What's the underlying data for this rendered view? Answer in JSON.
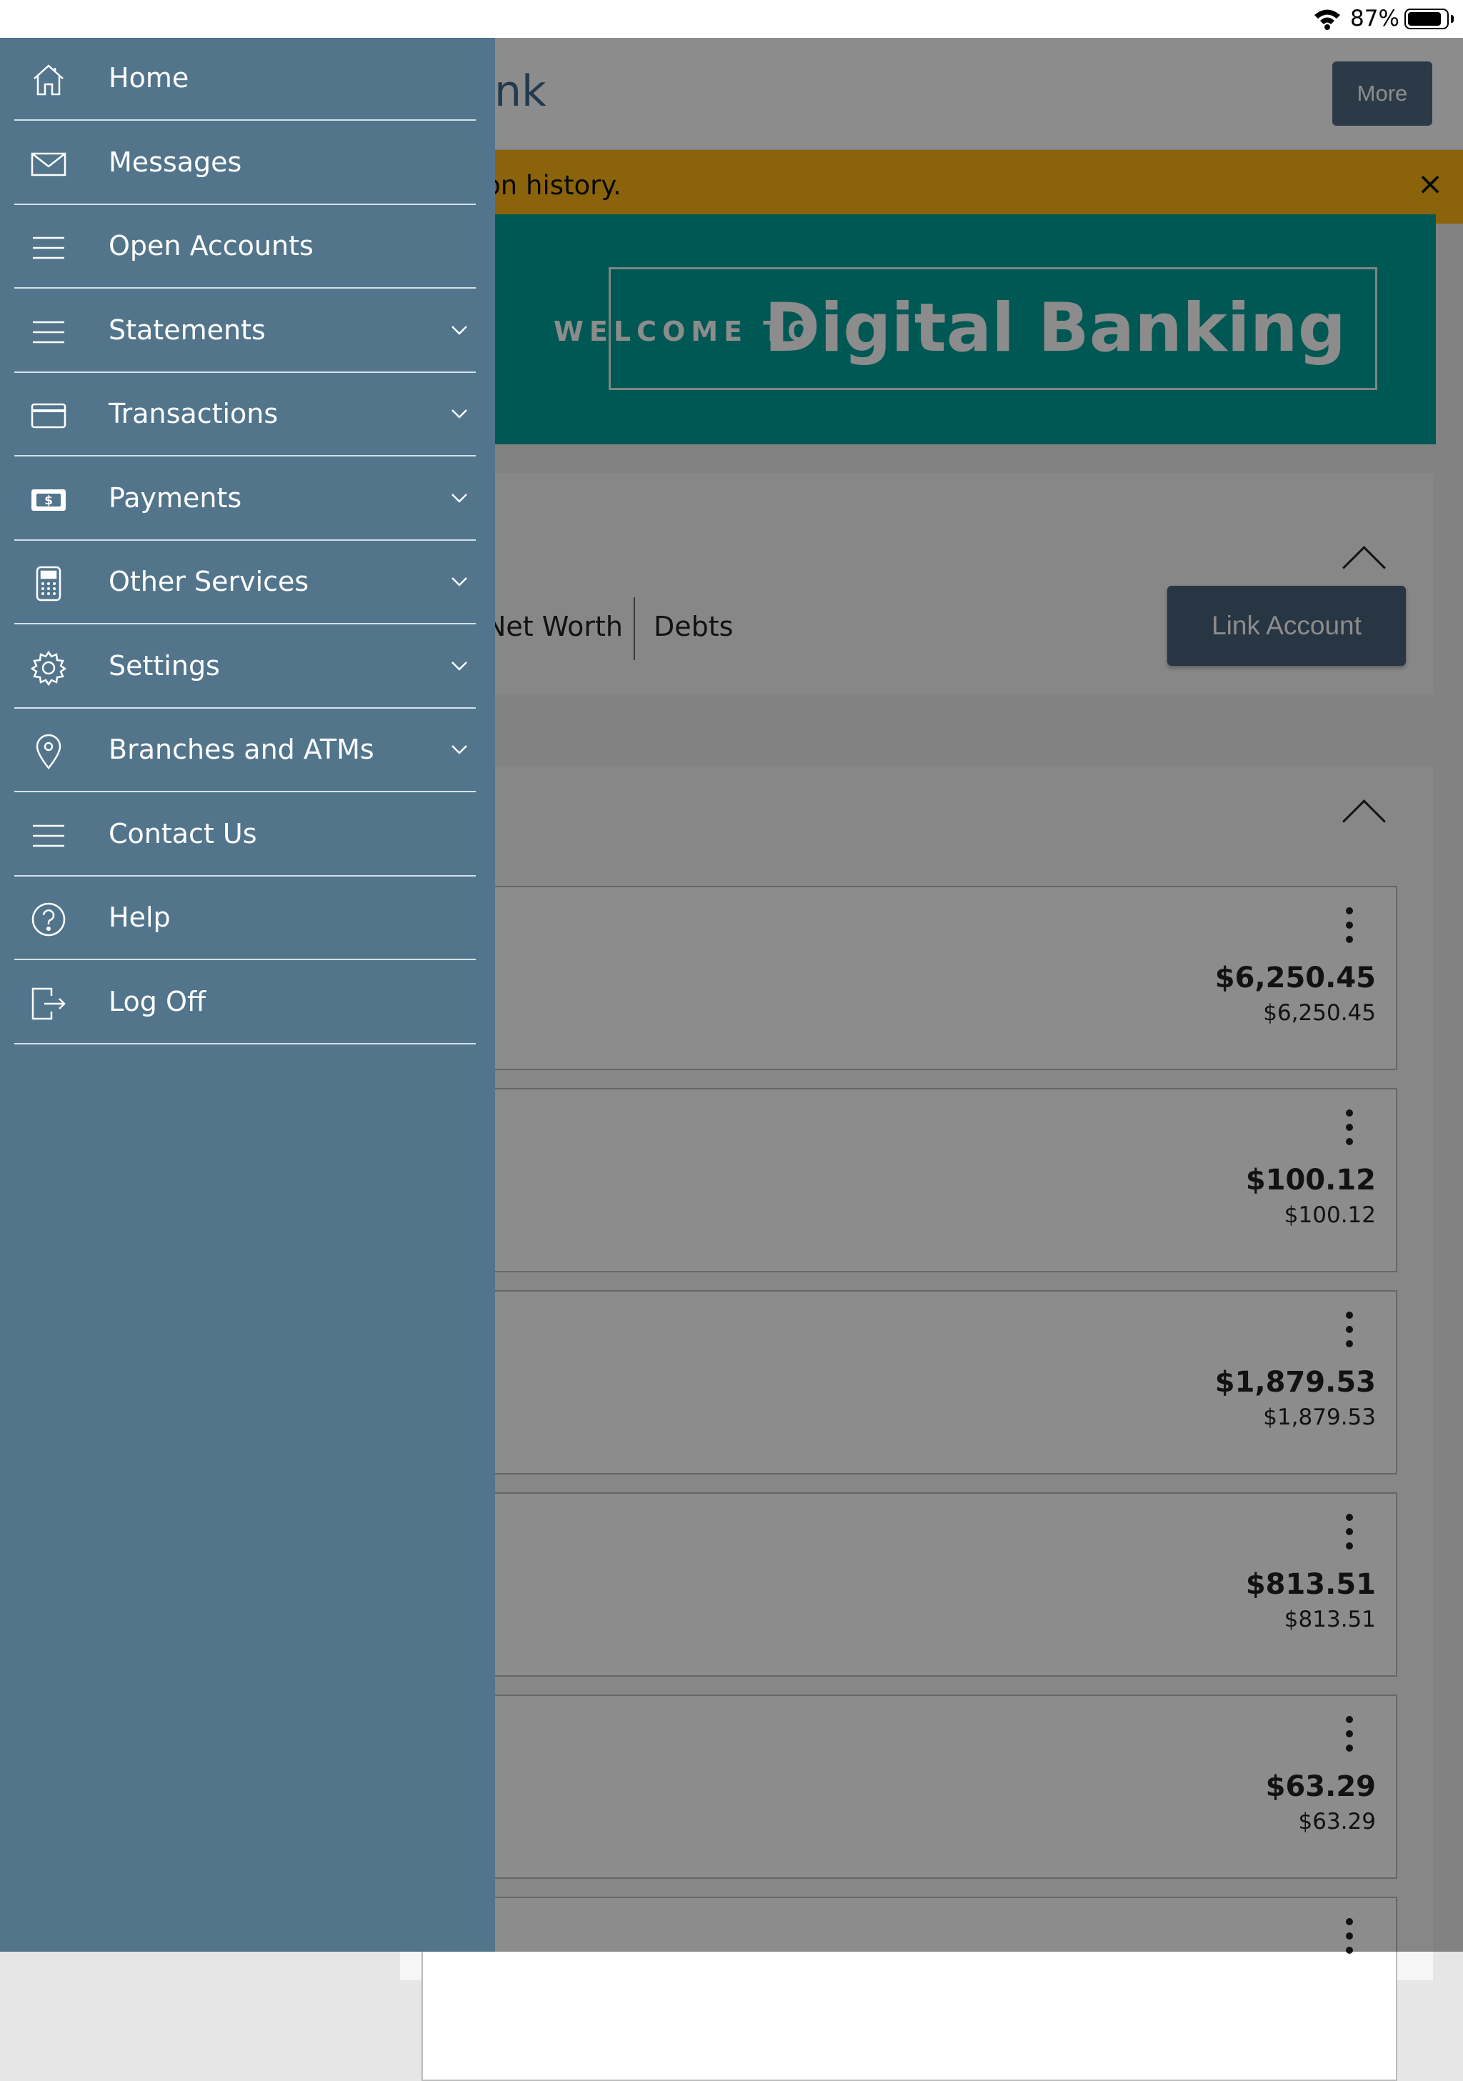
{
  "status_bar": {
    "battery_percent": "87%",
    "battery_level": 0.87
  },
  "header": {
    "bank_title": "ne Bank",
    "more_label": "More"
  },
  "alert": {
    "text": "d transaction history.",
    "close_symbol": "×"
  },
  "banner": {
    "welcome": "WELCOME TO",
    "headline": "Digital Banking"
  },
  "summary": {
    "tab_net_worth": "Net Worth",
    "tab_debts": "Debts",
    "link_account_label": "Link Account"
  },
  "accounts": [
    {
      "balance": "$6,250.45",
      "available": "$6,250.45"
    },
    {
      "balance": "$100.12",
      "available": "$100.12"
    },
    {
      "balance": "$1,879.53",
      "available": "$1,879.53"
    },
    {
      "balance": "$813.51",
      "available": "$813.51"
    },
    {
      "balance": "$63.29",
      "available": "$63.29"
    }
  ],
  "menu": {
    "items": [
      {
        "label": "Home",
        "icon": "home-icon",
        "expandable": false
      },
      {
        "label": "Messages",
        "icon": "envelope-icon",
        "expandable": false
      },
      {
        "label": "Open Accounts",
        "icon": "list-icon",
        "expandable": false
      },
      {
        "label": "Statements",
        "icon": "list-icon",
        "expandable": true
      },
      {
        "label": "Transactions",
        "icon": "credit-card-icon",
        "expandable": true
      },
      {
        "label": "Payments",
        "icon": "money-icon",
        "expandable": true
      },
      {
        "label": "Other Services",
        "icon": "calculator-icon",
        "expandable": true
      },
      {
        "label": "Settings",
        "icon": "gear-icon",
        "expandable": true
      },
      {
        "label": "Branches and ATMs",
        "icon": "map-pin-icon",
        "expandable": true
      },
      {
        "label": "Contact Us",
        "icon": "list-icon",
        "expandable": false
      },
      {
        "label": "Help",
        "icon": "help-circle-icon",
        "expandable": false
      },
      {
        "label": "Log Off",
        "icon": "logout-icon",
        "expandable": false
      }
    ]
  },
  "colors": {
    "drawer": "#52758c",
    "alert": "#fbb514",
    "banner": "#00a19a",
    "button": "#4a6278"
  }
}
